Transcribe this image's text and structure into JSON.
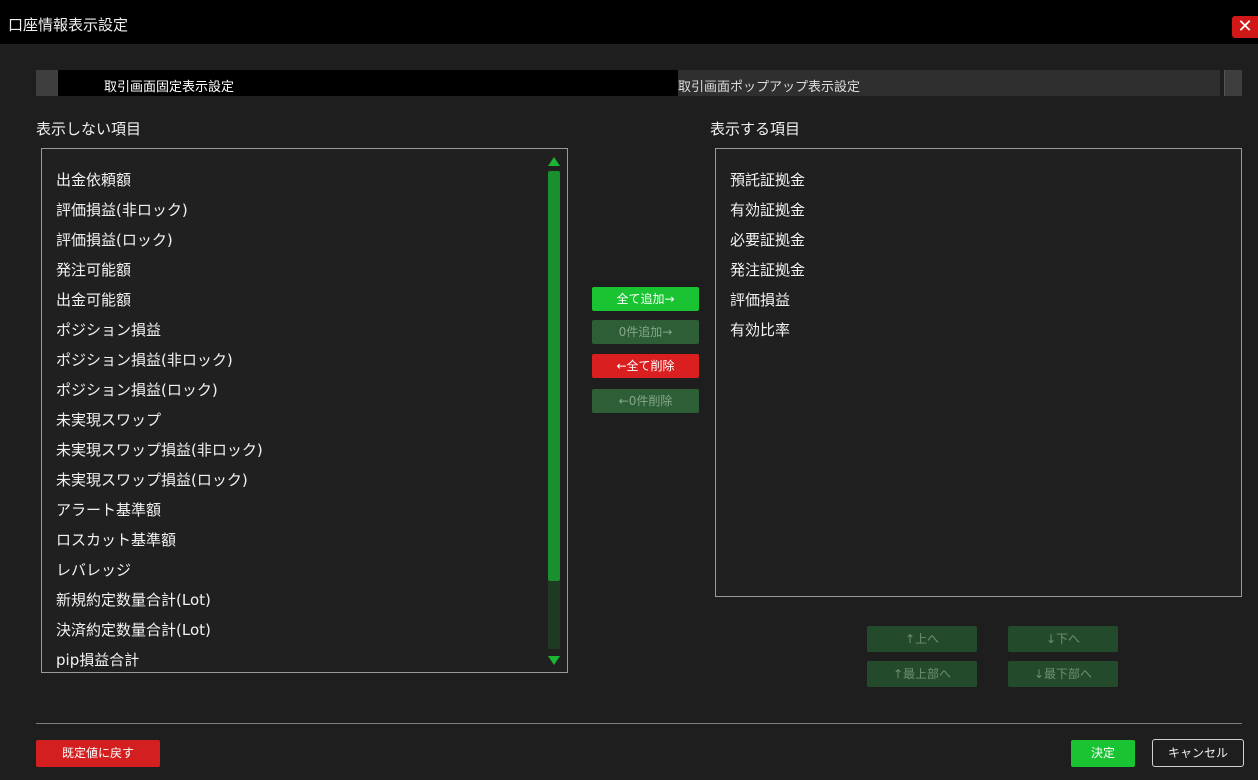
{
  "window": {
    "title": "口座情報表示設定",
    "close_label": "✕"
  },
  "tabs": [
    {
      "label": "取引画面固定表示設定",
      "active": true
    },
    {
      "label": "取引画面ポップアップ表示設定",
      "active": false
    }
  ],
  "hidden_items": {
    "heading": "表示しない項目",
    "items": [
      "出金依頼額",
      "評価損益(非ロック)",
      "評価損益(ロック)",
      "発注可能額",
      "出金可能額",
      "ポジション損益",
      "ポジション損益(非ロック)",
      "ポジション損益(ロック)",
      "未実現スワップ",
      "未実現スワップ損益(非ロック)",
      "未実現スワップ損益(ロック)",
      "アラート基準額",
      "ロスカット基準額",
      "レバレッジ",
      "新規約定数量合計(Lot)",
      "決済約定数量合計(Lot)",
      "pip損益合計"
    ]
  },
  "shown_items": {
    "heading": "表示する項目",
    "items": [
      "預託証拠金",
      "有効証拠金",
      "必要証拠金",
      "発注証拠金",
      "評価損益",
      "有効比率"
    ]
  },
  "transfer_buttons": {
    "add_all": "全て追加→",
    "add_n": "0件追加→",
    "remove_all": "←全て削除",
    "remove_n": "←0件削除"
  },
  "order_buttons": {
    "up": "↑上へ",
    "down": "↓下へ",
    "top": "↑最上部へ",
    "bottom": "↓最下部へ"
  },
  "footer": {
    "reset": "既定値に戻す",
    "ok": "決定",
    "cancel": "キャンセル"
  },
  "colors": {
    "accent_green": "#19c331",
    "danger_red": "#d91f1f",
    "background": "#1e1e1e"
  }
}
